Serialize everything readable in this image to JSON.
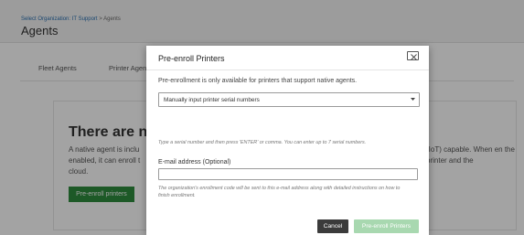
{
  "header": {
    "breadcrumb": {
      "org_link": "Select Organization: IT Support",
      "separator": ">",
      "current": "Agents"
    },
    "page_title": "Agents"
  },
  "tabs": [
    {
      "label": "Fleet Agents"
    },
    {
      "label": "Printer Agent"
    }
  ],
  "card": {
    "title": "There are no",
    "body_left": "A native agent is inclu enabled, it can enroll t cloud.",
    "body_right": "(IoT) capable. When en the printer and the",
    "button_label": "Pre-enroll printers"
  },
  "modal": {
    "title": "Pre-enroll Printers",
    "close_icon": "close-icon",
    "info_text": "Pre-enrollment is only available for printers that support native agents.",
    "select": {
      "value": "Manually input printer serial numbers",
      "caret_icon": "caret-down-icon"
    },
    "serial_hint": "Type a serial number and then press 'ENTER' or comma. You can enter up to 7 serial numbers.",
    "email": {
      "label": "E-mail address (Optional)",
      "value": "",
      "placeholder": "",
      "hint": "The organization's enrollment code will be sent to this e-mail address along with detailed instructions on how to finish enrollment."
    },
    "buttons": {
      "cancel": "Cancel",
      "primary": "Pre-enroll Printers"
    }
  },
  "colors": {
    "primary_green": "#2e8b3e",
    "primary_disabled": "#a8d8b0",
    "cancel_dark": "#3b3b3b",
    "link_blue": "#2a6fb0"
  }
}
